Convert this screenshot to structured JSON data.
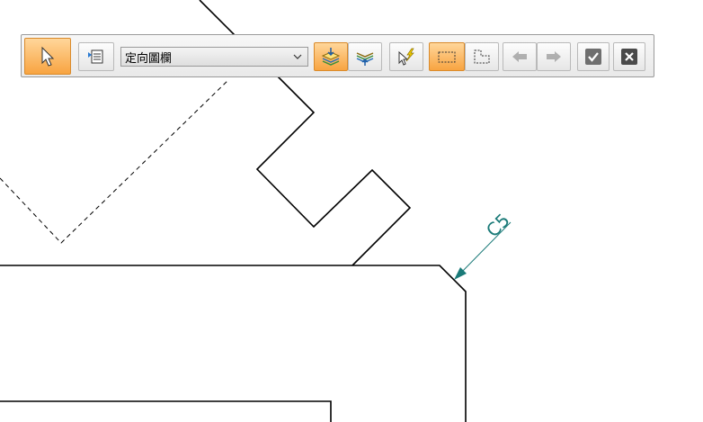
{
  "toolbar": {
    "select_tool_icon": "arrow-cursor-icon",
    "filter_icon": "list-filter-icon",
    "orientation_dropdown": {
      "selected": "定向圖欄",
      "icon": "chevron-down-icon"
    },
    "buttons": [
      {
        "name": "add-to-layer",
        "icon": "layers-add-icon",
        "state": "active"
      },
      {
        "name": "layers-stack",
        "icon": "layers-stack-icon",
        "state": "normal"
      },
      {
        "name": "select-sketch",
        "icon": "cursor-lightning-icon",
        "state": "normal"
      },
      {
        "name": "rectangle-region",
        "icon": "rectangle-dashed-icon",
        "state": "active"
      },
      {
        "name": "polygon-region",
        "icon": "polygon-dashed-icon",
        "state": "normal"
      },
      {
        "name": "previous",
        "icon": "arrow-left-icon",
        "state": "disabled"
      },
      {
        "name": "next",
        "icon": "arrow-right-icon",
        "state": "disabled"
      },
      {
        "name": "accept",
        "icon": "checkmark-icon",
        "state": "normal"
      },
      {
        "name": "cancel",
        "icon": "close-icon",
        "state": "normal"
      }
    ]
  },
  "drawing": {
    "chamfer_label": "C5",
    "dimension_color": "#1a7a78",
    "line_color": "#000000"
  }
}
